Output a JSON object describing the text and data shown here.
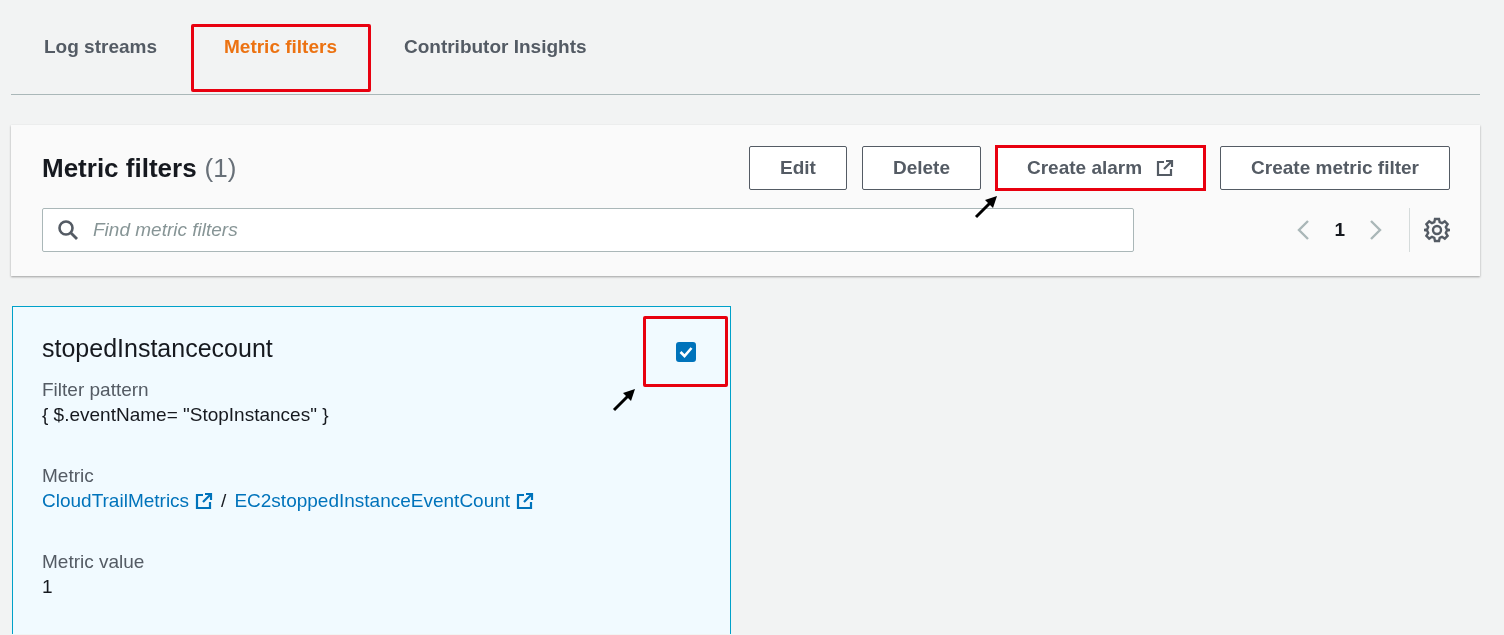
{
  "tabs": [
    {
      "label": "Log streams",
      "selected": false,
      "highlighted": false
    },
    {
      "label": "Metric filters",
      "selected": true,
      "highlighted": true
    },
    {
      "label": "Contributor Insights",
      "selected": false,
      "highlighted": false
    }
  ],
  "panel": {
    "title": "Metric filters",
    "count": "(1)",
    "buttons": [
      {
        "label": "Edit",
        "external": false,
        "highlighted": false,
        "pointed": false
      },
      {
        "label": "Delete",
        "external": false,
        "highlighted": false,
        "pointed": false
      },
      {
        "label": "Create alarm",
        "external": true,
        "highlighted": true,
        "pointed": true
      },
      {
        "label": "Create metric filter",
        "external": false,
        "highlighted": false,
        "pointed": false
      }
    ],
    "search": {
      "placeholder": "Find metric filters"
    },
    "pagination": {
      "page": "1"
    }
  },
  "cards": [
    {
      "title": "stopedInstancecount",
      "selected": true,
      "highlighted": true,
      "pointed": true,
      "fields": [
        {
          "kind": "text",
          "label": "Filter pattern",
          "value": "{ $.eventName= \"StopInstances\" }"
        },
        {
          "kind": "links",
          "label": "Metric",
          "links": [
            "CloudTrailMetrics",
            "EC2stoppedInstanceEventCount"
          ],
          "separator": "/"
        },
        {
          "kind": "text",
          "label": "Metric value",
          "value": "1"
        }
      ]
    }
  ]
}
